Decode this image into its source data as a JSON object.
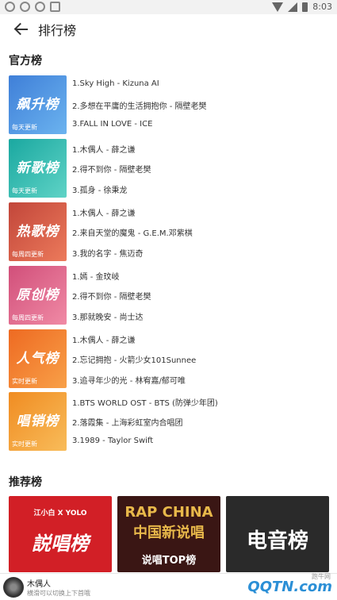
{
  "status": {
    "time": "8:03"
  },
  "header": {
    "title": "排行榜"
  },
  "official": {
    "title": "官方榜",
    "charts": [
      {
        "name": "飙升榜",
        "update": "每天更新",
        "color1": "#3f7fd8",
        "color2": "#6bb3ef",
        "tracks": [
          "1.Sky High - Kizuna AI",
          "2.多想在平庸的生活拥抱你 - 隔壁老樊",
          "3.FALL IN LOVE - ICE"
        ]
      },
      {
        "name": "新歌榜",
        "update": "每天更新",
        "color1": "#1aa8a0",
        "color2": "#5fd3c6",
        "tracks": [
          "1.木偶人 - 薛之谦",
          "2.得不到你 - 隔壁老樊",
          "3.孤身 - 徐秉龙"
        ]
      },
      {
        "name": "热歌榜",
        "update": "每周四更新",
        "color1": "#c2463a",
        "color2": "#ec7a5b",
        "tracks": [
          "1.木偶人 - 薛之谦",
          "2.来自天堂的魔鬼 - G.E.M.邓紫棋",
          "3.我的名字 - 焦迈奇"
        ]
      },
      {
        "name": "原创榜",
        "update": "每周四更新",
        "color1": "#d14f7a",
        "color2": "#f08aa5",
        "tracks": [
          "1.嫣 - 金玟岐",
          "2.得不到你 - 隔壁老樊",
          "3.那就晚安 - 尚士达"
        ]
      },
      {
        "name": "人气榜",
        "update": "实时更新",
        "color1": "#ee6a22",
        "color2": "#f8a048",
        "tracks": [
          "1.木偶人 - 薛之谦",
          "2.忘记拥抱 - 火箭少女101Sunnee",
          "3.追寻年少的光 - 林宥嘉/郁可唯"
        ]
      },
      {
        "name": "唱销榜",
        "update": "实时更新",
        "color1": "#f08c22",
        "color2": "#f8bc5a",
        "tracks": [
          "1.BTS WORLD OST - BTS (防弹少年团)",
          "2.落霞集 - 上海彩虹室内合唱团",
          "3.1989 - Taylor Swift"
        ]
      }
    ]
  },
  "recommended": {
    "title": "推荐榜",
    "items": [
      {
        "top": "江小白 X YOLO",
        "main": "説唱榜",
        "color": "#d21f26"
      },
      {
        "top": "RAP CHINA",
        "mid": "中国新说唱",
        "main": "说唱TOP榜",
        "color": "#3a1614"
      },
      {
        "main": "电音榜",
        "color": "#2a2a2a"
      }
    ]
  },
  "player": {
    "song": "木偶人",
    "hint": "横滑可以切换上下首哦"
  },
  "watermark": {
    "site": "跑牛网",
    "logo": "QQTN.com"
  }
}
